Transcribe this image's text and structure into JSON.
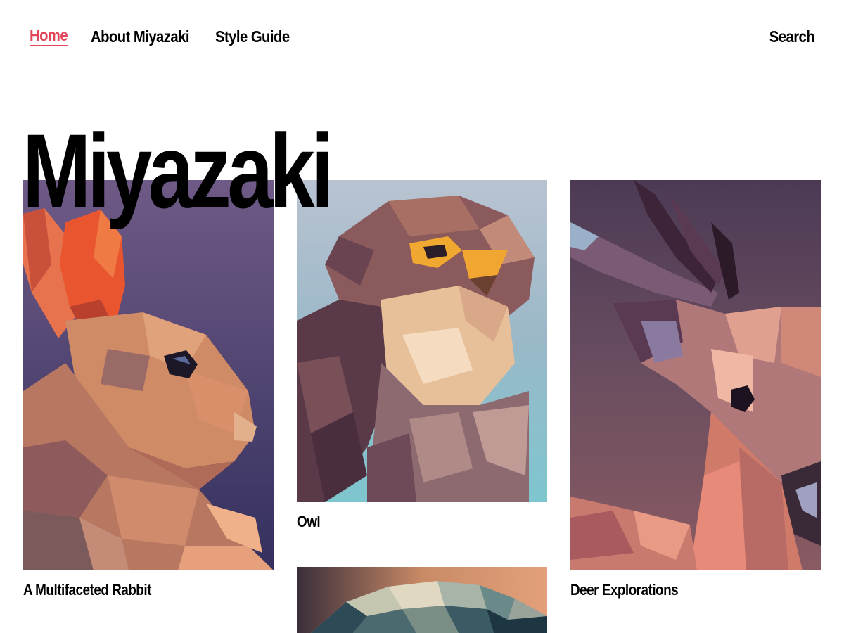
{
  "nav": {
    "items": [
      {
        "label": "Home",
        "active": true
      },
      {
        "label": "About Miyazaki",
        "active": false
      },
      {
        "label": "Style Guide",
        "active": false
      }
    ],
    "search_label": "Search",
    "accent_color": "#e2465a"
  },
  "site": {
    "title": "Miyazaki"
  },
  "posts": [
    {
      "title": "A Multifaceted Rabbit",
      "image": "low-poly rabbit illustration"
    },
    {
      "title": "Owl",
      "image": "low-poly owl illustration"
    },
    {
      "title": "Deer Explorations",
      "image": "low-poly deer illustration"
    },
    {
      "title": "",
      "image": "low-poly mountain illustration"
    }
  ]
}
